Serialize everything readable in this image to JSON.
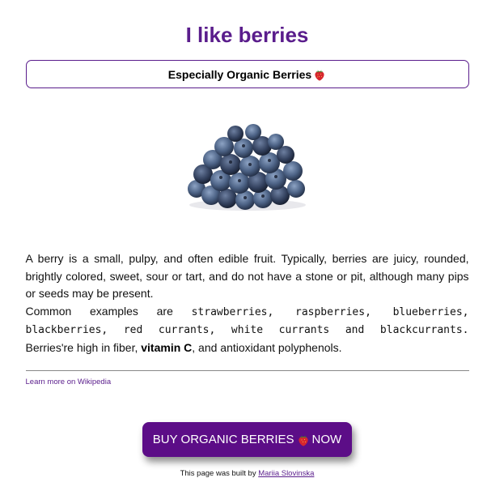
{
  "header": {
    "title": "I like berries",
    "subtitle": "Especially Organic Berries",
    "subtitle_icon": "strawberry-icon"
  },
  "hero": {
    "image_subject": "blueberries-icon"
  },
  "content": {
    "paragraph1": "A berry is a small, pulpy, and often edible fruit. Typically, berries are juicy, rounded, brightly colored, sweet, sour or tart, and do not have a stone or pit, although many pips or seeds may be present.",
    "examples_intro": "Common examples are ",
    "examples_list": "strawberries, raspberries, blueberries, blackberries, red currants, white currants and blackcurrants.",
    "fiber_prefix": "Berries're high in fiber, ",
    "fiber_bold": "vitamin C",
    "fiber_suffix": ", and antioxidant polyphenols."
  },
  "links": {
    "wikipedia": "Learn more on Wikipedia"
  },
  "cta": {
    "prefix": "BUY ORGANIC BERRIES",
    "icon": "strawberry-icon",
    "suffix": "NOW"
  },
  "footer": {
    "text": "This page was built by ",
    "author": "Mariia Slovinska"
  },
  "colors": {
    "accent": "#5a1d8c",
    "button_bg": "#5c0d87",
    "berry_red": "#d7262e"
  }
}
